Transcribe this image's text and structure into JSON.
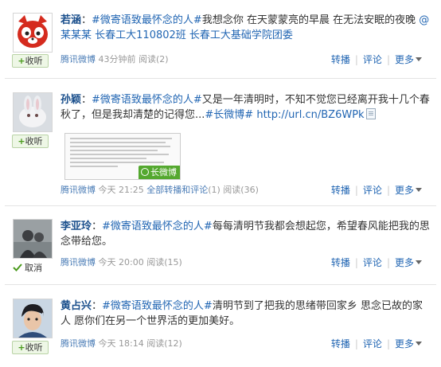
{
  "colors": {
    "link": "#2266b3",
    "author": "#1a4f8c",
    "meta": "#999999",
    "follow_bg": "#eef7e6",
    "badge": "#54a82f"
  },
  "icons": {
    "follow": "plus-icon",
    "unfollow": "checkmark-icon",
    "link": "page-icon",
    "more": "caret-down-icon",
    "long": "long-weibo-badge-icon"
  },
  "actions": {
    "forward": "转播",
    "comment": "评论",
    "more": "更多"
  },
  "posts": [
    {
      "author": "若涵",
      "colon": "：",
      "topic": "#微寄语致最怀念的人#",
      "text": "我想念你 在天蒙蒙亮的早晨 在无法安眠的夜晚 ",
      "mention": "@某某某",
      "text2": " 长春工大110802班 长春工大基础学院团委",
      "follow": {
        "plus": "+",
        "label": "收听"
      },
      "source": "腾讯微博",
      "time": "43分钟前",
      "read_label": "阅读",
      "read_count": "(2)"
    },
    {
      "author": "孙颖",
      "colon": "：",
      "topic": "#微寄语致最怀念的人#",
      "text": "又是一年清明时，不知不觉您已经离开我十几个春秋了，但是我却清楚的记得您...",
      "long_tag": "#长微博#",
      "link": " http://url.cn/BZ6WPk",
      "follow": {
        "plus": "+",
        "label": "收听"
      },
      "thumb_badge": "长微博",
      "source": "腾讯微博",
      "time": "今天 21:25",
      "forward_all": "全部转播和评论",
      "forward_count": "(1)",
      "read_label": "阅读",
      "read_count": "(36)"
    },
    {
      "author": "李亚玲",
      "colon": "：",
      "topic": "#微寄语致最怀念的人#",
      "text": "每每清明节我都会想起您，希望春风能把我的思念带给您。",
      "unfollow": {
        "label": "取消"
      },
      "source": "腾讯微博",
      "time": "今天 20:00",
      "read_label": "阅读",
      "read_count": "(15)"
    },
    {
      "author": "黄占兴",
      "colon": "：",
      "topic": "#微寄语致最怀念的人#",
      "text": "清明节到了把我的思绪带回家乡 思念已故的家人 愿你们在另一个世界活的更加美好。",
      "follow": {
        "plus": "+",
        "label": "收听"
      },
      "source": "腾讯微博",
      "time": "今天 18:14",
      "read_label": "阅读",
      "read_count": "(12)"
    }
  ]
}
